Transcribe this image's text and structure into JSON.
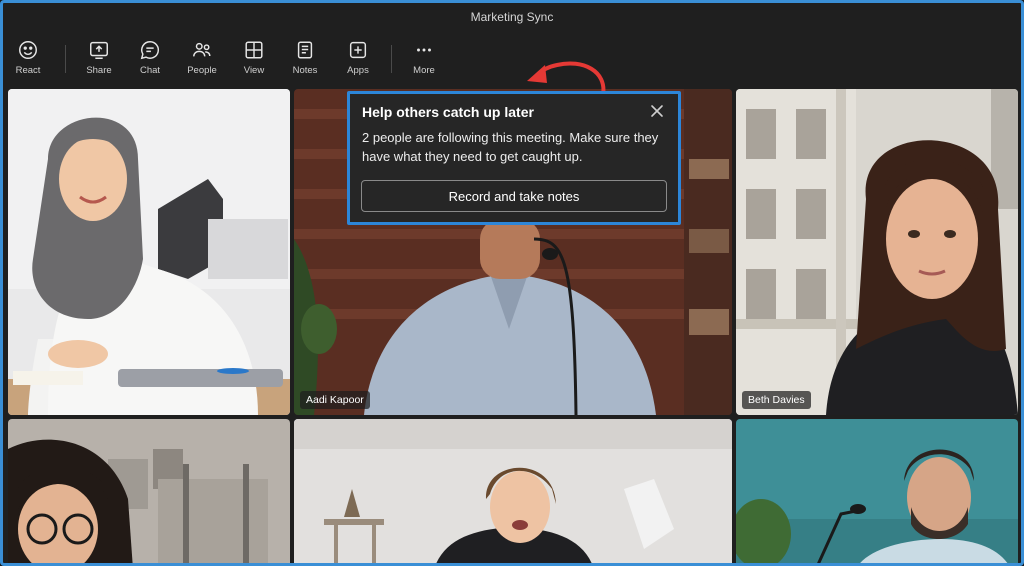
{
  "window": {
    "title": "Marketing Sync"
  },
  "toolbar": {
    "items": [
      {
        "label": "React",
        "icon": "smile-icon"
      },
      {
        "label": "Share",
        "icon": "share-icon"
      },
      {
        "label": "Chat",
        "icon": "chat-icon"
      },
      {
        "label": "People",
        "icon": "people-icon"
      },
      {
        "label": "View",
        "icon": "view-grid-icon"
      },
      {
        "label": "Notes",
        "icon": "notes-icon"
      },
      {
        "label": "Apps",
        "icon": "apps-icon"
      },
      {
        "label": "More",
        "icon": "more-icon"
      }
    ]
  },
  "popover": {
    "title": "Help others catch up later",
    "body": "2 people are following this meeting. Make sure they have what they need to get caught up.",
    "button_label": "Record and take notes",
    "accent": "#2c86d9"
  },
  "participants": [
    {
      "name": ""
    },
    {
      "name": "Aadi Kapoor"
    },
    {
      "name": "Beth Davies"
    },
    {
      "name": ""
    },
    {
      "name": ""
    },
    {
      "name": ""
    }
  ],
  "annotation": {
    "arrow_color": "#e53935"
  }
}
